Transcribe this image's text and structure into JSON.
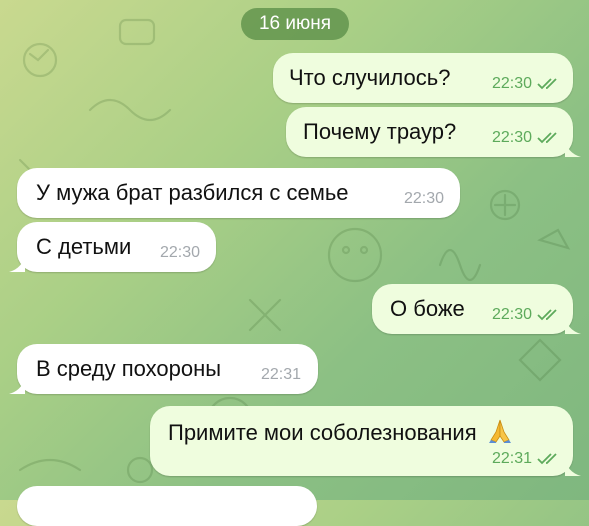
{
  "chat": {
    "date_label": "16 июня",
    "messages": [
      {
        "text": "Что случилось?",
        "time": "22:30",
        "direction": "out",
        "status": "read"
      },
      {
        "text": "Почему траур?",
        "time": "22:30",
        "direction": "out",
        "status": "read"
      },
      {
        "text": "У мужа брат разбился с семье",
        "time": "22:30",
        "direction": "in"
      },
      {
        "text": "С детьми",
        "time": "22:30",
        "direction": "in"
      },
      {
        "text": "О боже",
        "time": "22:30",
        "direction": "out",
        "status": "read"
      },
      {
        "text": "В среду похороны",
        "time": "22:31",
        "direction": "in"
      },
      {
        "text": "Примите мои соболезнования",
        "time": "22:31",
        "direction": "out",
        "status": "read",
        "emoji": "praying-hands"
      }
    ]
  },
  "colors": {
    "outgoing_bubble": "#effdde",
    "incoming_bubble": "#ffffff",
    "read_check": "#5daa5b",
    "incoming_time": "#a3a8ad",
    "date_pill": "#588c46"
  },
  "icons": [
    "double-check-icon",
    "praying-hands-emoji"
  ]
}
